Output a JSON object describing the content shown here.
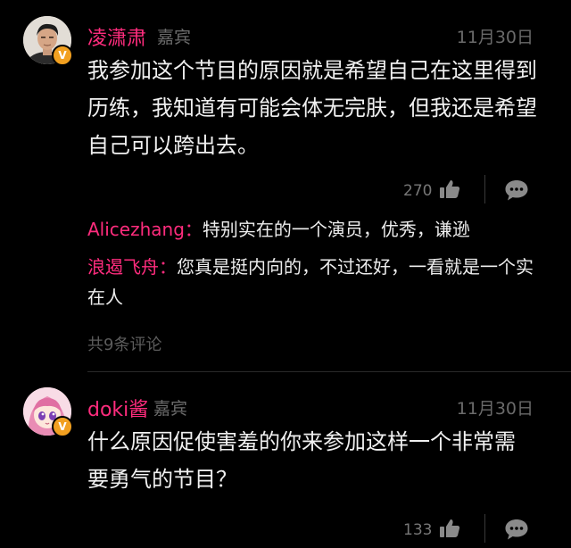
{
  "comments": [
    {
      "username": "凌潇肃",
      "role": "嘉宾",
      "date": "11月30日",
      "badge": "V",
      "avatar_icon": "male-portrait-avatar",
      "text": "我参加这个节目的原因就是希望自己在这里得到历练，我知道有可能会体无完肤，但我还是希望自己可以跨出去。",
      "likes": "270",
      "replies": [
        {
          "name": "Alicezhang：",
          "text": "特别实在的一个演员，优秀，谦逊"
        },
        {
          "name": "浪遏飞舟：",
          "text": "您真是挺内向的，不过还好，一看就是一个实在人"
        }
      ],
      "total_replies": "共9条评论"
    },
    {
      "username": "doki酱",
      "role": "嘉宾",
      "date": "11月30日",
      "badge": "V",
      "avatar_icon": "anime-girl-avatar",
      "text": "什么原因促使害羞的你来参加这样一个非常需要勇气的节目？",
      "likes": "133"
    }
  ],
  "icons": {
    "like": "thumbs-up-icon",
    "comment": "comment-bubble-icon"
  },
  "colors": {
    "background": "#000000",
    "username": "#ff2c7d",
    "muted": "#6a6a6a",
    "badge": "#f2a020"
  }
}
